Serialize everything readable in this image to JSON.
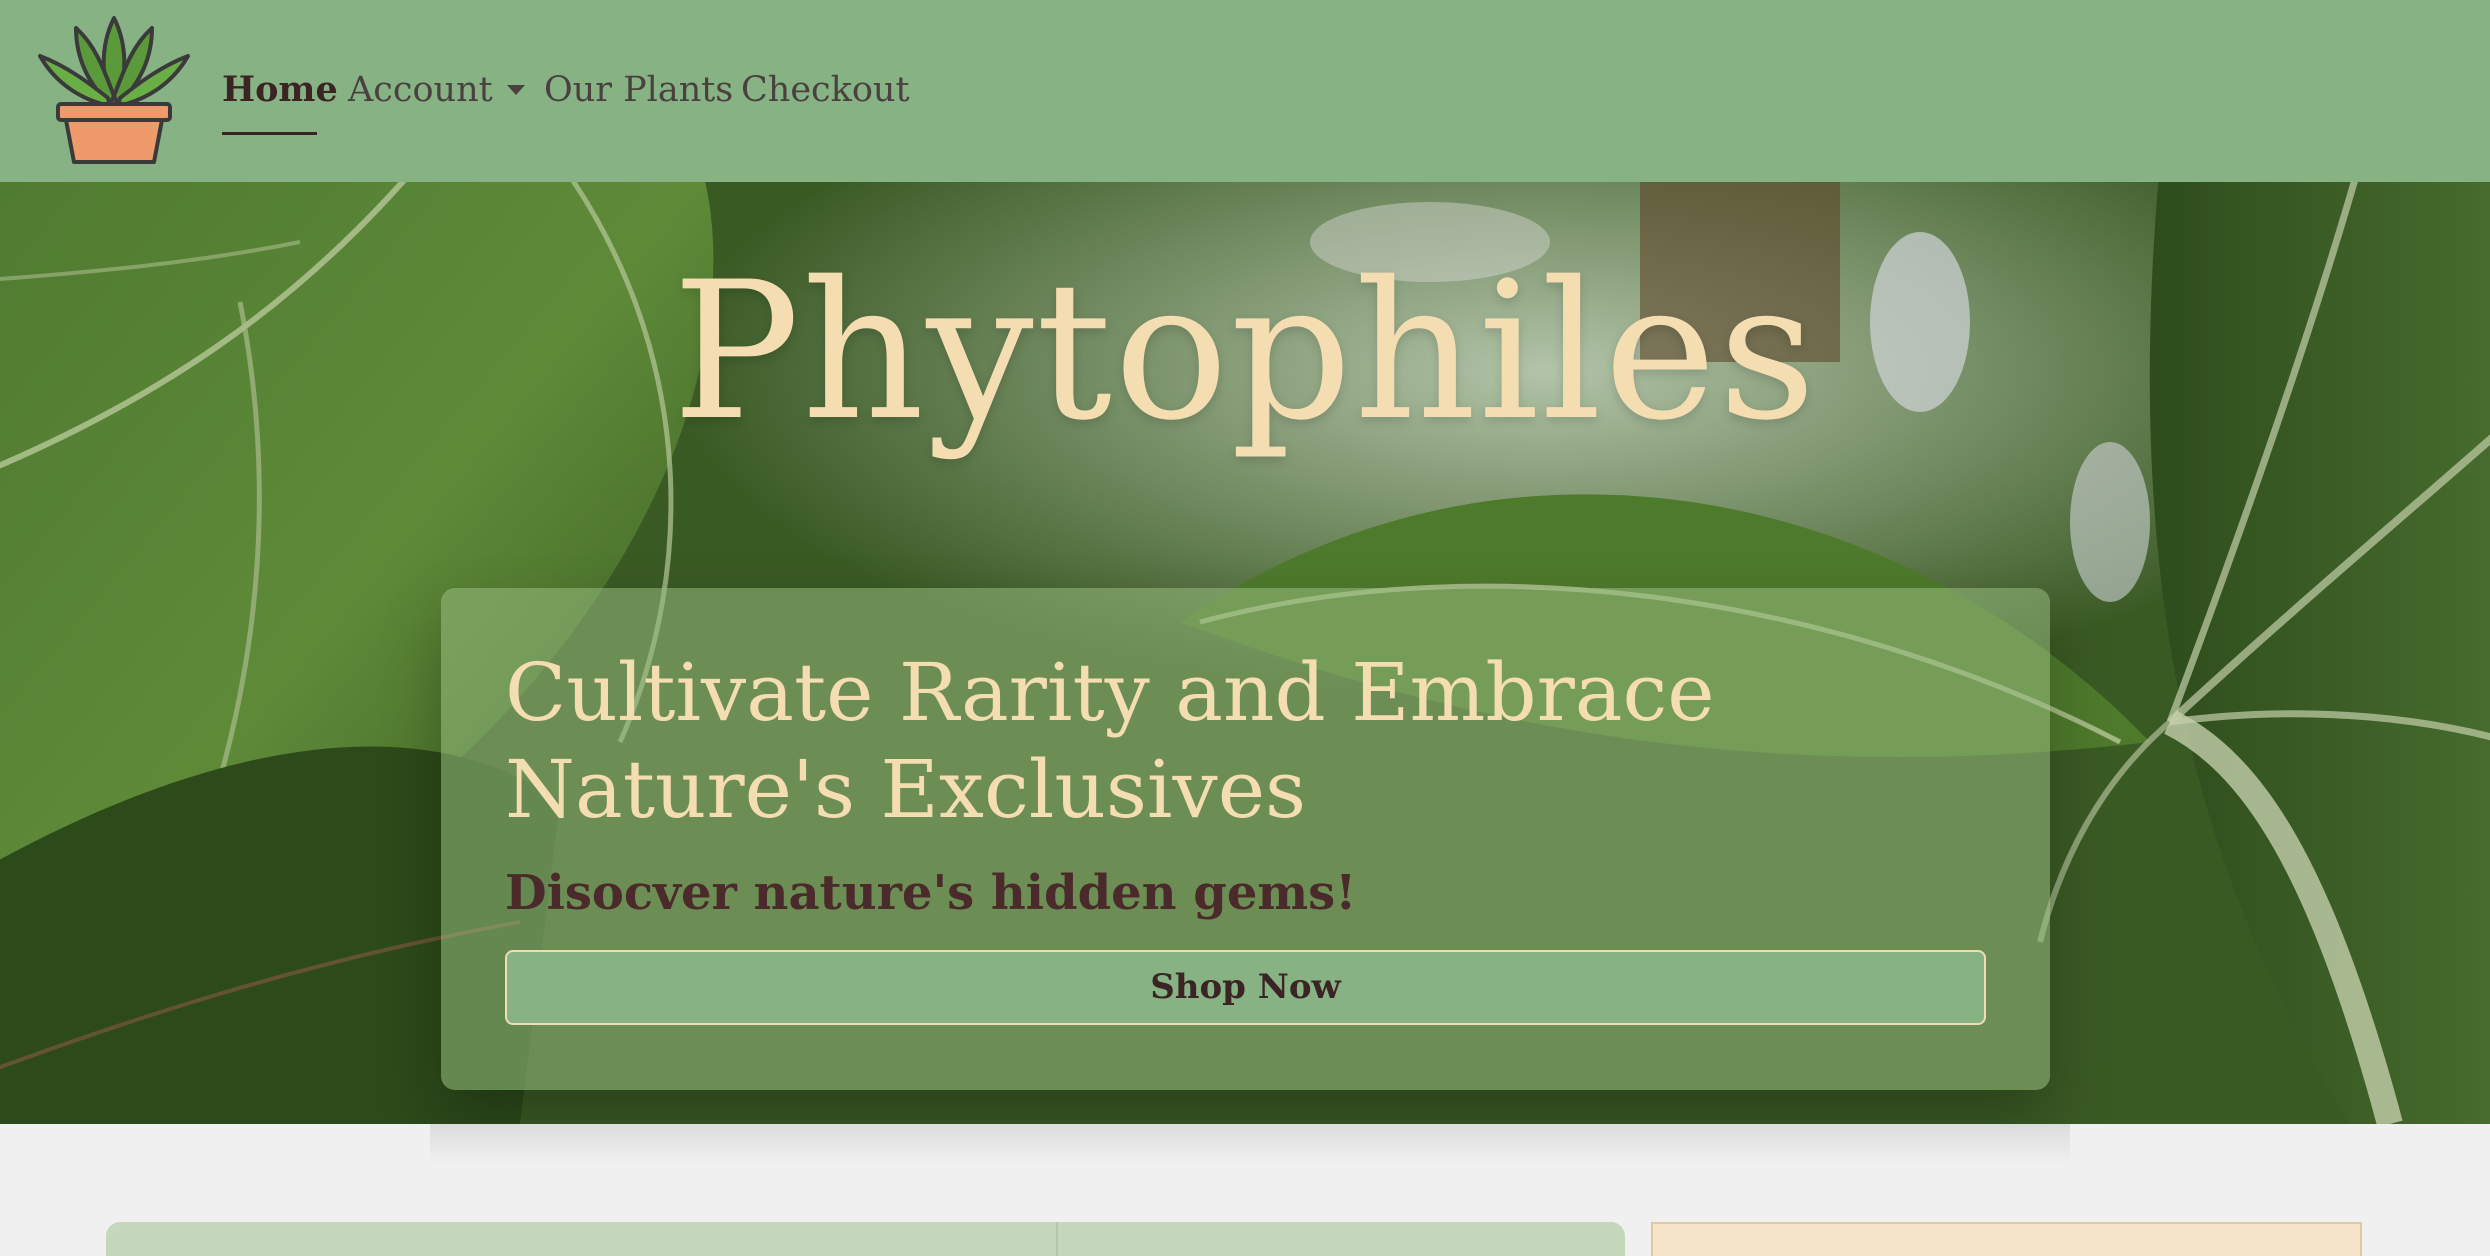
{
  "navbar": {
    "logo_alt": "potted-plant-logo",
    "items": [
      {
        "label": "Home",
        "active": true
      },
      {
        "label": "Account",
        "has_dropdown": true
      },
      {
        "label": "Our Plants"
      },
      {
        "label": "Checkout"
      }
    ]
  },
  "hero": {
    "title": "Phytophiles",
    "heading": "Cultivate Rarity and Embrace Nature's Exclusives",
    "subheading": "Disocver nature's hidden gems!",
    "cta_label": "Shop Now"
  },
  "colors": {
    "nav_bg": "#86b284",
    "accent_cream": "#f5ddb2",
    "text_dark": "#3b2424",
    "page_bg": "#f0f0f0"
  }
}
